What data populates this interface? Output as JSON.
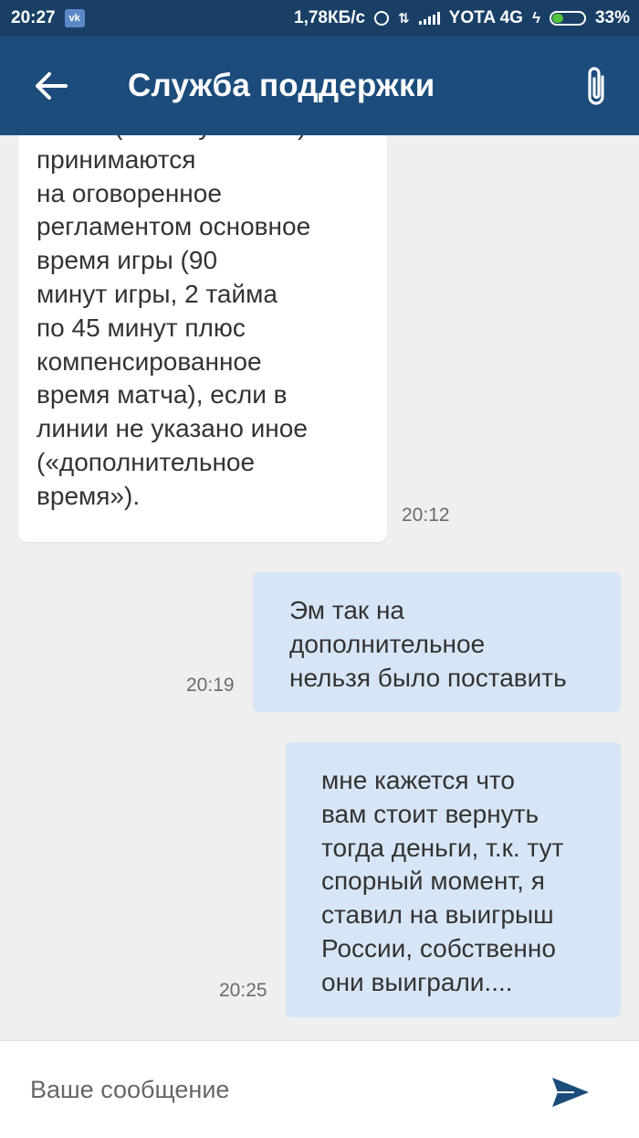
{
  "status_bar": {
    "time": "20:27",
    "vk_badge": "vk",
    "speed": "1,78КБ/с",
    "carrier": "YOTA 4G",
    "battery": "33%",
    "battery_level": 0.33,
    "icons": [
      "vk-icon",
      "alarm-icon",
      "data-arrows-icon",
      "signal-icon",
      "charging-bolt-icon",
      "battery-icon"
    ],
    "colors": {
      "background": "#1a3f66",
      "battery_fill": "#52c33a"
    }
  },
  "app_bar": {
    "title": "Служба поддержки",
    "back_icon": "arrow-left-icon",
    "attach_icon": "paperclip-icon",
    "colors": {
      "background": "#1c4c7c"
    }
  },
  "messages": [
    {
      "direction": "incoming",
      "text": "матчи (в т.ч. кубковые)\nпринимаются\nна оговоренное\nрегламентом основное\nвремя игры (90\nминут игры, 2 тайма\nпо 45 минут плюс\nкомпенсированное\nвремя матча), если в\nлинии не указано иное\n(«дополнительное\nвремя»).",
      "time": "20:12"
    },
    {
      "direction": "outgoing",
      "text": "Эм так на\nдополнительное\nнельзя было поставить",
      "time": "20:19"
    },
    {
      "direction": "outgoing",
      "text": "мне кажется что\nвам стоит вернуть\nтогда деньги, т.к. тут\nспорный момент, я\nставил на выигрыш\nРоссии, собственно\nони выиграли....",
      "time": "20:25"
    }
  ],
  "composer": {
    "placeholder": "Ваше сообщение",
    "send_icon": "send-icon",
    "colors": {
      "send": "#1c4c7c",
      "outgoing_bubble": "#d7e6f6"
    }
  }
}
